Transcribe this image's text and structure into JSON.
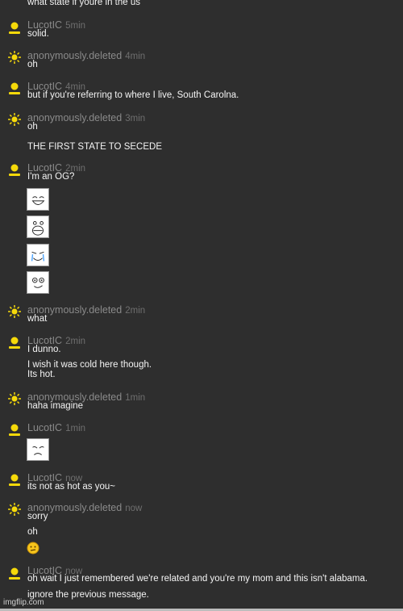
{
  "messages": [
    {
      "lines": [
        "what state if youre in the us"
      ]
    },
    {
      "user": "LucotIC",
      "time": "5min",
      "lines": [
        "solid."
      ]
    },
    {
      "user": "anonymously.deleted",
      "time": "4min",
      "lines": [
        "oh"
      ]
    },
    {
      "user": "LucotIC",
      "time": "4min",
      "lines": [
        "but if you're referring to where I live, South Carolna."
      ]
    },
    {
      "user": "anonymously.deleted",
      "time": "3min",
      "lines": [
        "oh",
        "THE FIRST STATE TO SECEDE"
      ]
    },
    {
      "user": "LucotIC",
      "time": "2min",
      "lines": [
        "I'm an OG?"
      ],
      "memes": [
        "happy-meme-face-icon",
        "laughing-meme-face-icon",
        "crying-meme-face-icon",
        "derp-meme-face-icon"
      ]
    },
    {
      "user": "anonymously.deleted",
      "time": "2min",
      "lines": [
        "what"
      ]
    },
    {
      "user": "LucotIC",
      "time": "2min",
      "lines": [
        "I dunno.",
        "I wish it was cold here though.",
        "Its hot."
      ]
    },
    {
      "user": "anonymously.deleted",
      "time": "1min",
      "lines": [
        "haha imagine"
      ]
    },
    {
      "user": "LucotIC",
      "time": "1min",
      "lines": [],
      "memes": [
        "sad-meme-face-icon"
      ]
    },
    {
      "user": "LucotIC",
      "time": "now",
      "lines": [
        "its not as hot as you~"
      ]
    },
    {
      "user": "anonymously.deleted",
      "time": "now",
      "lines": [
        "sorry",
        "oh"
      ],
      "emoji": "neutral-face-emoji-icon"
    },
    {
      "user": "LucotIC",
      "time": "now",
      "lines": [
        "oh wait I just remembered we're related and you're my mom and this isn't alabama.",
        "ignore the previous message."
      ]
    }
  ],
  "footer": {
    "watermark": "imgflip.com"
  },
  "colors": {
    "background": "#2e2e2e",
    "username": "#8a8a8a",
    "timestamp": "#6f6f6f",
    "text": "#f4f4f4",
    "user_icon": "#f5d90a"
  }
}
